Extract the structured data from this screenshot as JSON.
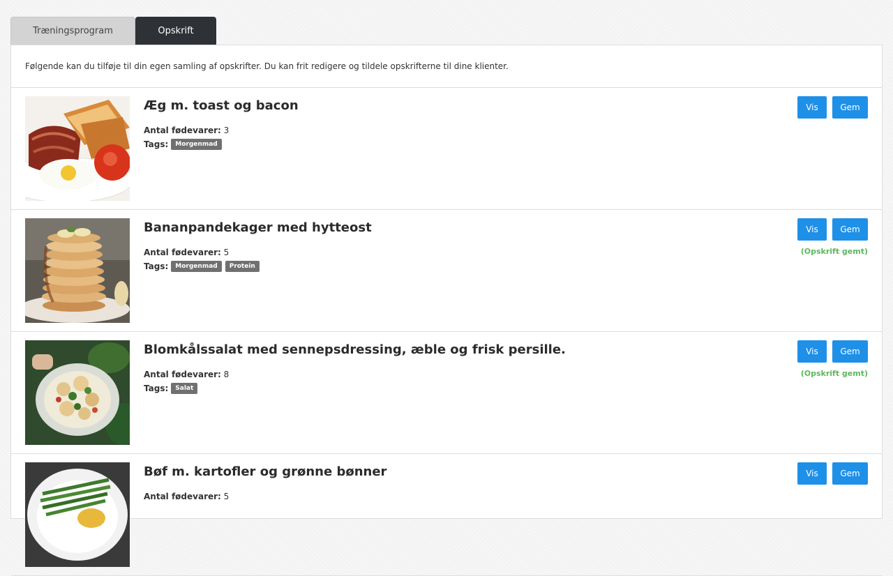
{
  "tabs": [
    {
      "label": "Træningsprogram"
    },
    {
      "label": "Opskrift"
    }
  ],
  "intro": "Følgende kan du tilføje til din egen samling af opskrifter. Du kan frit redigere og tildele opskrifterne til dine klienter.",
  "labels": {
    "ingredients": "Antal fødevarer:",
    "tags": "Tags:",
    "view": "Vis",
    "save": "Gem"
  },
  "recipes": [
    {
      "title": "Æg m. toast og bacon",
      "count": "3",
      "tags": [
        "Morgenmad"
      ],
      "saved": ""
    },
    {
      "title": "Bananpandekager med hytteost",
      "count": "5",
      "tags": [
        "Morgenmad",
        "Protein"
      ],
      "saved": "(Opskrift gemt)"
    },
    {
      "title": "Blomkålssalat med sennepsdressing, æble og frisk persille.",
      "count": "8",
      "tags": [
        "Salat"
      ],
      "saved": "(Opskrift gemt)"
    },
    {
      "title": "Bøf m. kartofler og grønne bønner",
      "count": "5",
      "tags": [],
      "saved": ""
    }
  ]
}
